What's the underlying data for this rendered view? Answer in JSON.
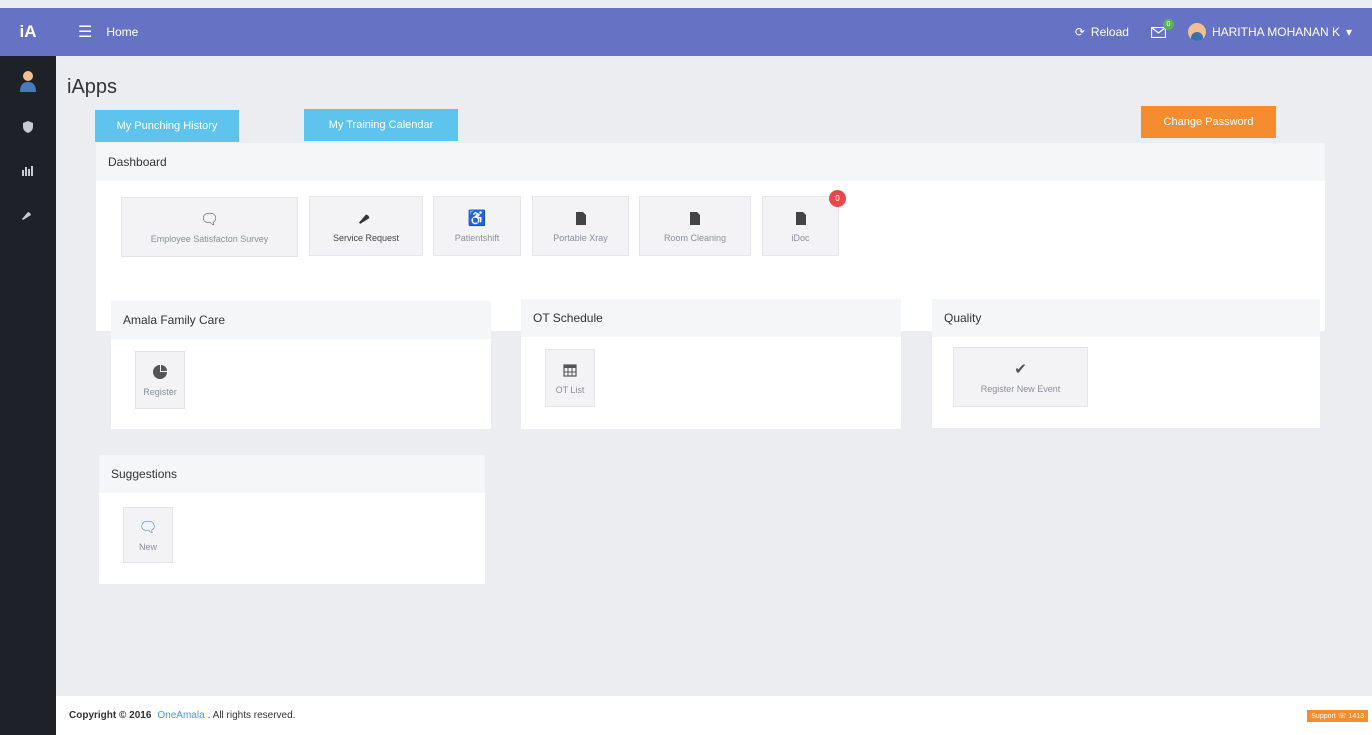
{
  "topbar": {
    "brand": "iA",
    "breadcrumb": "Home",
    "reload_label": "Reload",
    "mail_count": "0",
    "user_name": "HARITHA MOHANAN K",
    "user_caret": "▾",
    "colors": {
      "bar": "#6673c4"
    }
  },
  "sidebar": {
    "items": [
      {
        "icon": "user-icon"
      },
      {
        "icon": "shield-icon"
      },
      {
        "icon": "bar-chart-icon"
      },
      {
        "icon": "wrench-icon"
      }
    ]
  },
  "page": {
    "title": "iApps",
    "buttons": {
      "punching_history": "My Punching History",
      "training_calendar": "My Training Calendar",
      "change_password": "Change Password"
    }
  },
  "dashboard": {
    "title": "Dashboard",
    "tiles": [
      {
        "label": "Employee Satisfacton Survey",
        "icon": "comment-icon"
      },
      {
        "label": "Service Request",
        "icon": "wrench-icon"
      },
      {
        "label": "Patientshift",
        "icon": "wheelchair-icon"
      },
      {
        "label": "Portable Xray",
        "icon": "file-icon"
      },
      {
        "label": "Room Cleaning",
        "icon": "file-icon"
      },
      {
        "label": "iDoc",
        "icon": "file-icon",
        "badge": "0"
      }
    ]
  },
  "amala": {
    "title": "Amala Family Care",
    "tiles": [
      {
        "label": "Register",
        "icon": "pie-chart-icon"
      }
    ]
  },
  "ot": {
    "title": "OT Schedule",
    "tiles": [
      {
        "label": "OT List",
        "icon": "calendar-icon"
      }
    ]
  },
  "quality": {
    "title": "Quality",
    "tiles": [
      {
        "label": "Register New Event",
        "icon": "check-icon"
      }
    ]
  },
  "suggestions": {
    "title": "Suggestions",
    "tiles": [
      {
        "label": "New",
        "icon": "comment-icon"
      }
    ]
  },
  "footer": {
    "copyright": "Copyright © 2016",
    "brand": "OneAmala",
    "rights": ". All rights reserved.",
    "support": "Support ☏ 1413"
  }
}
